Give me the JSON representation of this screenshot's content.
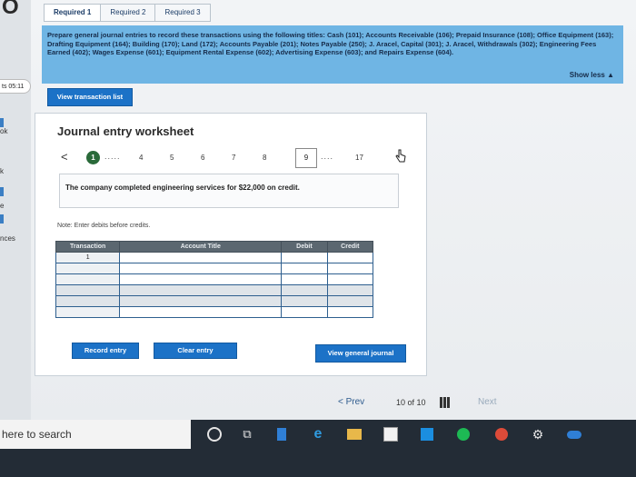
{
  "tabs": [
    "Required 1",
    "Required 2",
    "Required 3"
  ],
  "left_edge": {
    "logo": "O",
    "tab_label": "ts 05:11",
    "fragments": [
      "ok",
      "k",
      "e",
      "nces"
    ]
  },
  "prompt": {
    "text": "Prepare general journal entries to record these transactions using the following titles: Cash (101); Accounts Receivable (106); Prepaid Insurance (108); Office Equipment (163); Drafting Equipment (164); Building (170); Land (172); Accounts Payable (201); Notes Payable (250); J. Aracel, Capital (301); J. Aracel, Withdrawals (302); Engineering Fees Earned (402); Wages Expense (601); Equipment Rental Expense (602); Advertising Expense (603); and Repairs Expense (604).",
    "show_less": "Show less ▲"
  },
  "view_transaction_list": "View transaction list",
  "worksheet": {
    "title": "Journal entry worksheet",
    "prev_icon": "<",
    "current": "1",
    "pages": [
      "4",
      "5",
      "6",
      "7",
      "8",
      "9",
      "17"
    ],
    "ellipsis": ".....",
    "ellipsis2": "....",
    "description": "The company completed engineering services for $22,000 on credit.",
    "note": "Note: Enter debits before credits.",
    "columns": [
      "Transaction",
      "Account Title",
      "Debit",
      "Credit"
    ],
    "first_transaction": "1",
    "rows": 6,
    "record_entry": "Record entry",
    "clear_entry": "Clear entry",
    "view_general_journal": "View general journal"
  },
  "navigation": {
    "prev": "< Prev",
    "count": "10 of 10",
    "next": "Next"
  },
  "taskbar": {
    "search_placeholder": "here to search"
  }
}
